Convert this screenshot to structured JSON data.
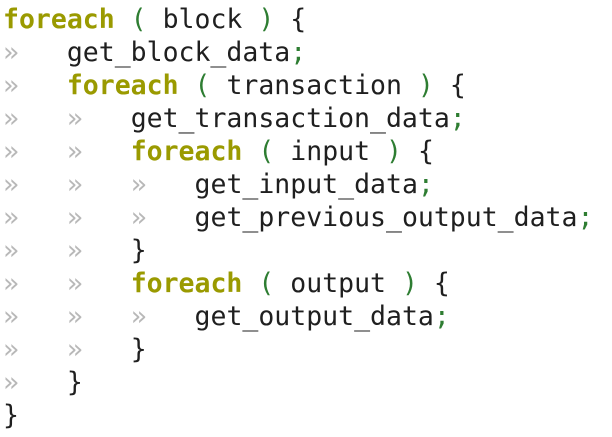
{
  "editor": {
    "guide_char": "»",
    "colors": {
      "keyword": "#9a9a00",
      "paren": "#2e7d32",
      "semicolon": "#2e7d32",
      "text": "#1f1f1f",
      "indent_guide": "#b8b8b8",
      "background": "#ffffff"
    },
    "lines": [
      {
        "indent": 0,
        "type": "loop",
        "keyword": "foreach",
        "open_paren": "(",
        "arg": "block",
        "close_paren": ")",
        "brace": "{"
      },
      {
        "indent": 1,
        "type": "stmt",
        "text": "get_block_data",
        "semi": ";"
      },
      {
        "indent": 1,
        "type": "loop",
        "keyword": "foreach",
        "open_paren": "(",
        "arg": "transaction",
        "close_paren": ")",
        "brace": "{"
      },
      {
        "indent": 2,
        "type": "stmt",
        "text": "get_transaction_data",
        "semi": ";"
      },
      {
        "indent": 2,
        "type": "loop",
        "keyword": "foreach",
        "open_paren": "(",
        "arg": "input",
        "close_paren": ")",
        "brace": "{"
      },
      {
        "indent": 3,
        "type": "stmt",
        "text": "get_input_data",
        "semi": ";"
      },
      {
        "indent": 3,
        "type": "stmt",
        "text": "get_previous_output_data",
        "semi": ";"
      },
      {
        "indent": 2,
        "type": "close",
        "brace": "}"
      },
      {
        "indent": 2,
        "type": "loop",
        "keyword": "foreach",
        "open_paren": "(",
        "arg": "output",
        "close_paren": ")",
        "brace": "{"
      },
      {
        "indent": 3,
        "type": "stmt",
        "text": "get_output_data",
        "semi": ";"
      },
      {
        "indent": 2,
        "type": "close",
        "brace": "}"
      },
      {
        "indent": 1,
        "type": "close",
        "brace": "}"
      },
      {
        "indent": 0,
        "type": "close",
        "brace": "}"
      }
    ]
  }
}
